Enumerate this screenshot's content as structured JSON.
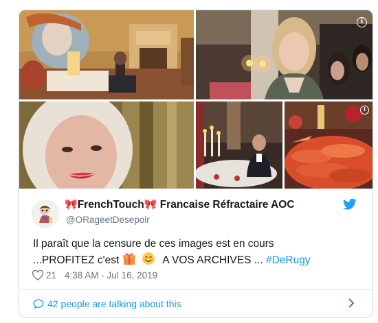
{
  "tweet": {
    "display_name_bow_left": "🎀",
    "display_name_main": "FrenchTouch",
    "display_name_bow_right": "🎀",
    "display_name_rest": " Francaise Réfractaire AOC",
    "handle": "@ORageetDesepoir",
    "text_line1": "Il paraît que la censure de ces images est en cours",
    "text_line2_a": "...PROFITEZ c'est",
    "text_line2_b": "A VOS ARCHIVES ...",
    "hashtag": "#DeRugy",
    "like_count": "21",
    "timestamp": "4:38 AM - Jul 16, 2019"
  },
  "footer": {
    "talking_text": "42 people are talking about this"
  },
  "icons": {
    "twitter_bird": "twitter-bird-icon",
    "heart": "heart-icon",
    "speech_bubble": "speech-bubble-icon",
    "chevron": "chevron-right-icon",
    "info": "info-icon",
    "gift_emoji": "gift-emoji",
    "smile_emoji": "smiling-face-emoji"
  },
  "info_glyph": "i",
  "colors": {
    "link_blue": "#1b95e0",
    "twitter_blue": "#1da1f2",
    "muted_gray": "#657786",
    "bow_red": "#d21f3c"
  }
}
